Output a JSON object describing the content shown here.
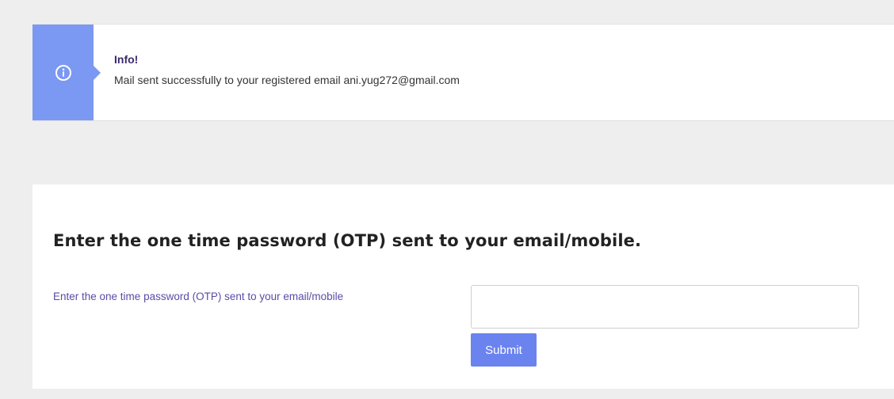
{
  "alert": {
    "icon": "info-circle-icon",
    "title": "Info!",
    "message": "Mail sent successfully to your registered email ani.yug272@gmail.com",
    "accent_color": "#7b98f2"
  },
  "otp_form": {
    "heading": "Enter the one time password (OTP) sent to your email/mobile.",
    "field_label": "Enter the one time password (OTP) sent to your email/mobile",
    "input_value": "",
    "submit_label": "Submit",
    "button_color": "#6a83ef"
  }
}
